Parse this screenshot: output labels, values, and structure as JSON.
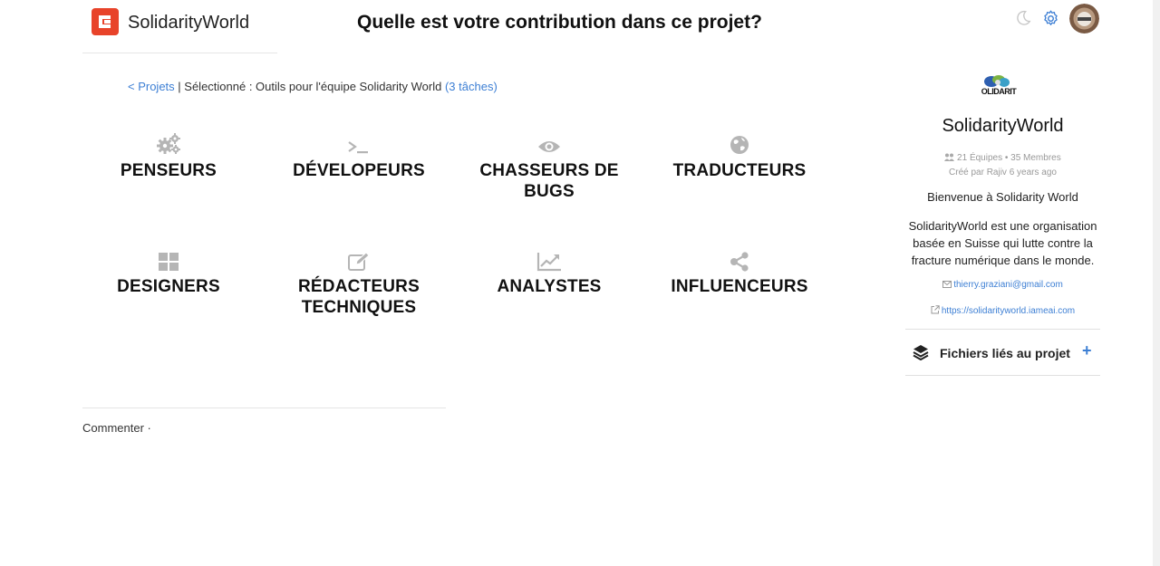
{
  "header": {
    "brand": "SolidarityWorld",
    "title": "Quelle est votre contribution dans ce projet?",
    "icons": [
      "moon-icon",
      "gear-icon",
      "avatar"
    ]
  },
  "breadcrumb": {
    "back_link": "< Projets",
    "separator": " | ",
    "selected": "Sélectionné : Outils pour l'équipe Solidarity World",
    "task_count": "(3 tâches)"
  },
  "roles": [
    {
      "label": "PENSEURS",
      "icon": "cogs-icon"
    },
    {
      "label": "DÉVELOPEURS",
      "icon": "terminal-icon"
    },
    {
      "label": "CHASSEURS DE BUGS",
      "icon": "eye-icon"
    },
    {
      "label": "TRADUCTEURS",
      "icon": "globe-icon"
    },
    {
      "label": "DESIGNERS",
      "icon": "grid-icon"
    },
    {
      "label": "RÉDACTEURS TECHNIQUES",
      "icon": "edit-icon"
    },
    {
      "label": "ANALYSTES",
      "icon": "line-chart-icon"
    },
    {
      "label": "INFLUENCEURS",
      "icon": "share-icon"
    }
  ],
  "comments": {
    "label": "Commenter ·"
  },
  "organization": {
    "name": "SolidarityWorld",
    "stats": "21 Équipes • 35 Membres",
    "created": "Créé par Rajiv 6 years ago",
    "welcome": "Bienvenue à Solidarity World",
    "description": "SolidarityWorld est une organisation basée en Suisse qui lutte contre la fracture numérique dans le monde.",
    "email": "thierry.graziani@gmail.com",
    "website": "https://solidarityworld.iameai.com",
    "logo_text": "OLIDARIT"
  },
  "files": {
    "label": "Fichiers liés au projet",
    "add": "+"
  },
  "colors": {
    "accent": "#3d7fd4",
    "brand": "#e8432a",
    "icon_gray": "#b5b5b5"
  }
}
